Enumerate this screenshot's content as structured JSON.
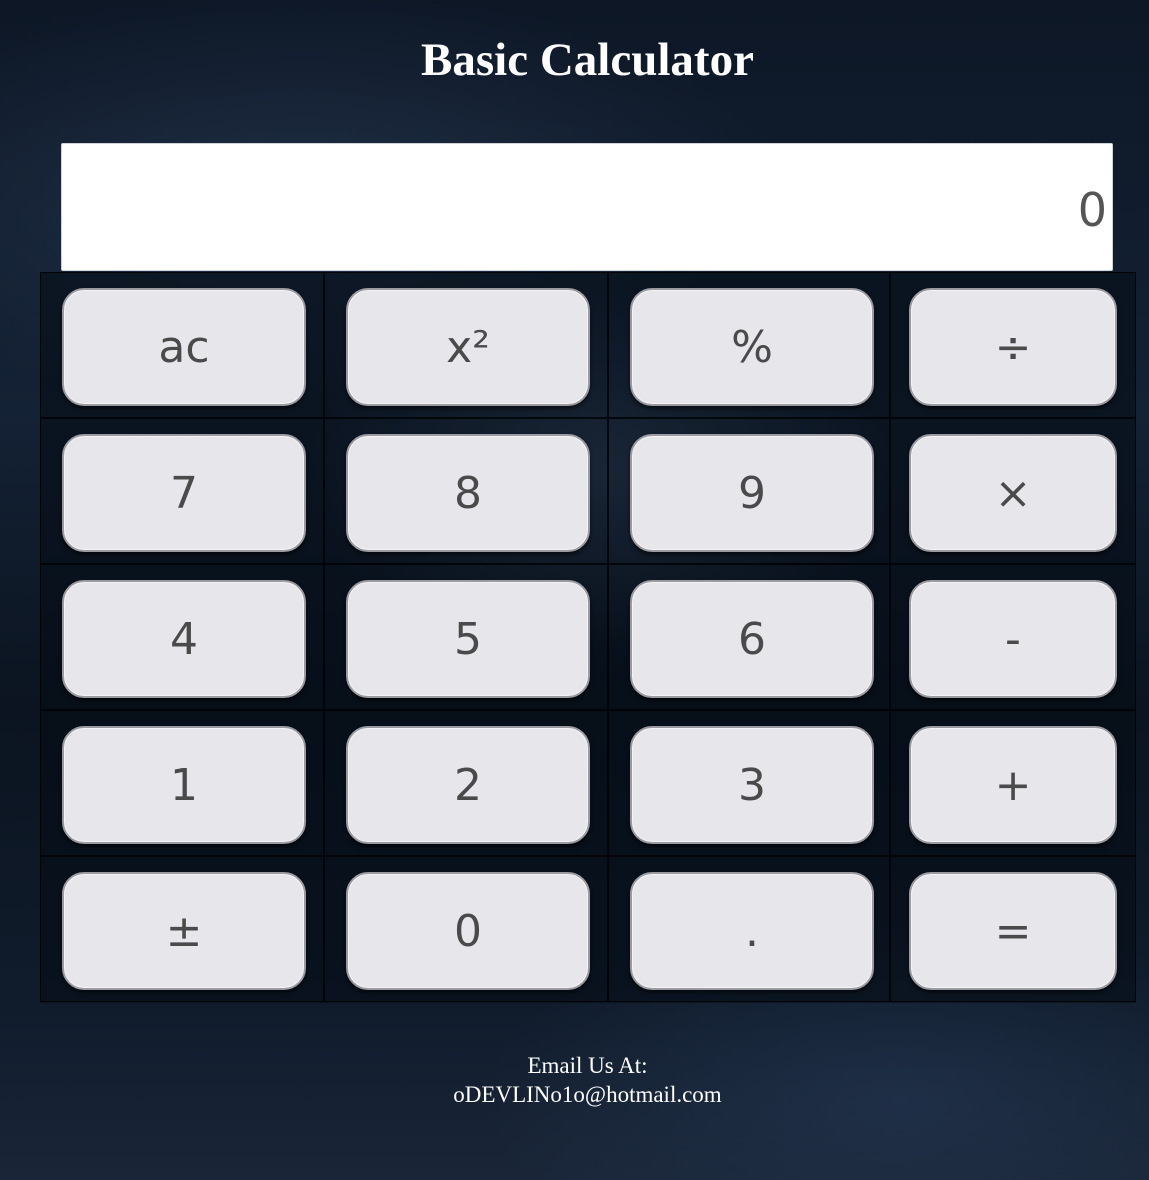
{
  "header": {
    "title": "Basic Calculator"
  },
  "display": {
    "value": "0"
  },
  "keypad": {
    "keys": [
      [
        "ac",
        "x²",
        "%",
        "÷"
      ],
      [
        "7",
        "8",
        "9",
        "×"
      ],
      [
        "4",
        "5",
        "6",
        "-"
      ],
      [
        "1",
        "2",
        "3",
        "+"
      ],
      [
        "±",
        "0",
        ".",
        "="
      ]
    ]
  },
  "footer": {
    "label": "Email Us At:",
    "email": "oDEVLINo1o@hotmail.com"
  }
}
